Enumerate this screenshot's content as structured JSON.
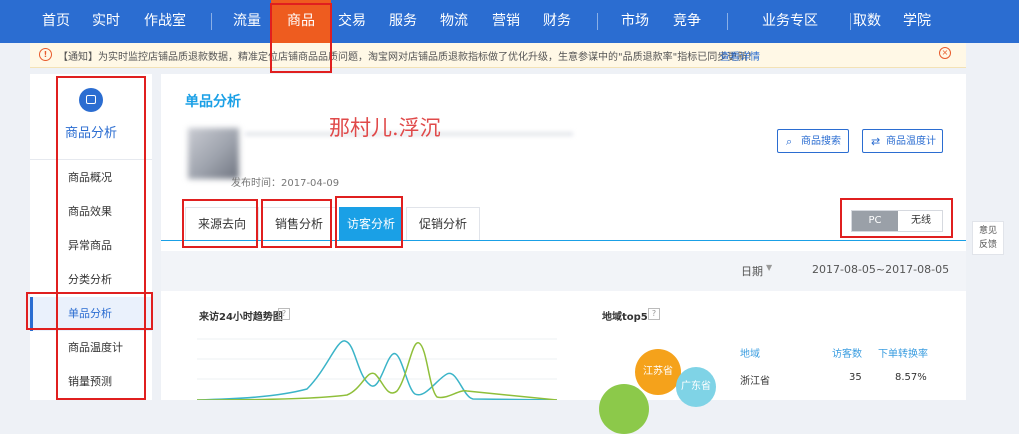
{
  "topnav": {
    "items": [
      {
        "label": "首页",
        "active": false
      },
      {
        "label": "实时",
        "active": false
      },
      {
        "label": "作战室",
        "active": false
      },
      {
        "label": "流量",
        "active": false
      },
      {
        "label": "商品",
        "active": true
      },
      {
        "label": "交易",
        "active": false
      },
      {
        "label": "服务",
        "active": false
      },
      {
        "label": "物流",
        "active": false
      },
      {
        "label": "营销",
        "active": false
      },
      {
        "label": "财务",
        "active": false
      },
      {
        "label": "市场",
        "active": false
      },
      {
        "label": "竞争",
        "active": false
      },
      {
        "label": "业务专区",
        "active": false
      },
      {
        "label": "取数",
        "active": false
      },
      {
        "label": "学院",
        "active": false
      }
    ]
  },
  "notice": {
    "text": "【通知】为实时监控店铺品质退款数据，精准定位店铺商品品质问题，淘宝网对店铺品质退款指标做了优化升级，生意参谋中的\"品质退款率\"指标已同步更新！",
    "link": "查看详情"
  },
  "sidebar": {
    "title": "商品分析",
    "items": [
      {
        "label": "商品概况",
        "active": false
      },
      {
        "label": "商品效果",
        "active": false
      },
      {
        "label": "异常商品",
        "active": false
      },
      {
        "label": "分类分析",
        "active": false
      },
      {
        "label": "单品分析",
        "active": true
      },
      {
        "label": "商品温度计",
        "active": false
      },
      {
        "label": "销量预测",
        "active": false
      }
    ]
  },
  "main": {
    "title": "单品分析",
    "watermark": "那村儿.浮沉",
    "publish_date": "发布时间：2017-04-09",
    "search_button": "商品搜索",
    "thermometer_button": "商品温度计",
    "tabs": [
      {
        "label": "来源去向",
        "active": false
      },
      {
        "label": "销售分析",
        "active": false
      },
      {
        "label": "访客分析",
        "active": true
      },
      {
        "label": "促销分析",
        "active": false
      }
    ],
    "device_toggle": {
      "pc": "PC",
      "wireless": "无线",
      "selected": "PC"
    },
    "date_label": "日期",
    "date_range": "2017-08-05~2017-08-05"
  },
  "trend_panel": {
    "title": "来访24小时趋势图",
    "help": "?",
    "colors": {
      "series_a": "#3bb4c8",
      "series_b": "#8fbf3a"
    }
  },
  "region_panel": {
    "title": "地域top5",
    "help": "?",
    "headers": [
      "地域",
      "访客数",
      "下单转换率"
    ],
    "rows": [
      {
        "region": "浙江省",
        "visitors": "35",
        "conversion": "8.57%"
      }
    ],
    "bubbles": [
      {
        "label": "江苏省",
        "color": "#f5a21b"
      },
      {
        "label": "广东省",
        "color": "#7fd3e6"
      }
    ]
  },
  "feedback": {
    "line1": "意见",
    "line2": "反馈"
  },
  "icons": {
    "shop": "bag-icon",
    "search": "search-icon",
    "thermometer": "exchange-icon",
    "warning": "warning-icon",
    "close": "close-icon"
  }
}
